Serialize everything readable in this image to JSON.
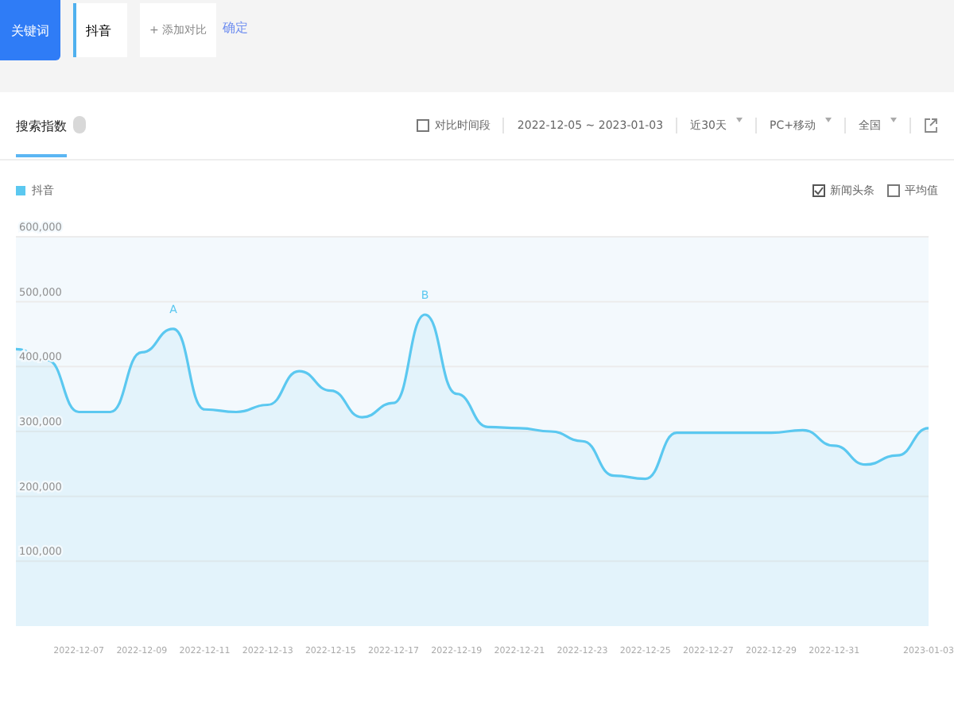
{
  "search_bar": {
    "tag": "关键词",
    "keyword": "抖音",
    "add_button": "+ 添加对比",
    "confirm_link": "确定"
  },
  "tabs": [
    {
      "label": "搜索指数",
      "selected": true
    }
  ],
  "toolbar": {
    "compare": {
      "label": "对比时间段",
      "checked": false
    },
    "date_range": "2022-12-05 ~ 2023-01-03",
    "period": "近30天",
    "platform": "PC+移动",
    "region": "全国"
  },
  "options": [
    {
      "label": "新闻头条",
      "checked": true
    },
    {
      "label": "平均值",
      "checked": false
    }
  ],
  "chart_data": {
    "type": "area",
    "x": [
      "2022-12-05",
      "2022-12-06",
      "2022-12-07",
      "2022-12-08",
      "2022-12-09",
      "2022-12-10",
      "2022-12-11",
      "2022-12-12",
      "2022-12-13",
      "2022-12-14",
      "2022-12-15",
      "2022-12-16",
      "2022-12-17",
      "2022-12-18",
      "2022-12-19",
      "2022-12-20",
      "2022-12-21",
      "2022-12-22",
      "2022-12-23",
      "2022-12-24",
      "2022-12-25",
      "2022-12-26",
      "2022-12-27",
      "2022-12-28",
      "2022-12-29",
      "2022-12-30",
      "2022-12-31",
      "2023-01-01",
      "2023-01-02",
      "2023-01-03"
    ],
    "xlim": [
      "2022-12-05",
      "2023-01-03"
    ],
    "xticks": [
      "2022-12-07",
      "2022-12-09",
      "2022-12-11",
      "2022-12-13",
      "2022-12-15",
      "2022-12-17",
      "2022-12-19",
      "2022-12-21",
      "2022-12-23",
      "2022-12-25",
      "2022-12-27",
      "2022-12-29",
      "2022-12-31",
      "2023-01-03"
    ],
    "series": [
      {
        "name": "抖音",
        "color": "#5bc8f0",
        "values": [
          427000,
          410000,
          330000,
          330000,
          422000,
          458000,
          334000,
          330000,
          341000,
          393000,
          363000,
          322000,
          344000,
          480000,
          358000,
          307000,
          305000,
          300000,
          285000,
          232000,
          227000,
          298000,
          298000,
          298000,
          298000,
          302000,
          278000,
          249000,
          263000,
          305000
        ]
      }
    ],
    "ylim": [
      0,
      600000
    ],
    "yticks": [
      {
        "value": 100000,
        "label": "100,000"
      },
      {
        "value": 200000,
        "label": "200,000"
      },
      {
        "value": 300000,
        "label": "300,000"
      },
      {
        "value": 400000,
        "label": "400,000"
      },
      {
        "value": 500000,
        "label": "500,000"
      },
      {
        "value": 600000,
        "label": "600,000"
      }
    ],
    "grid": true,
    "annotations": [
      "A",
      "B"
    ]
  }
}
